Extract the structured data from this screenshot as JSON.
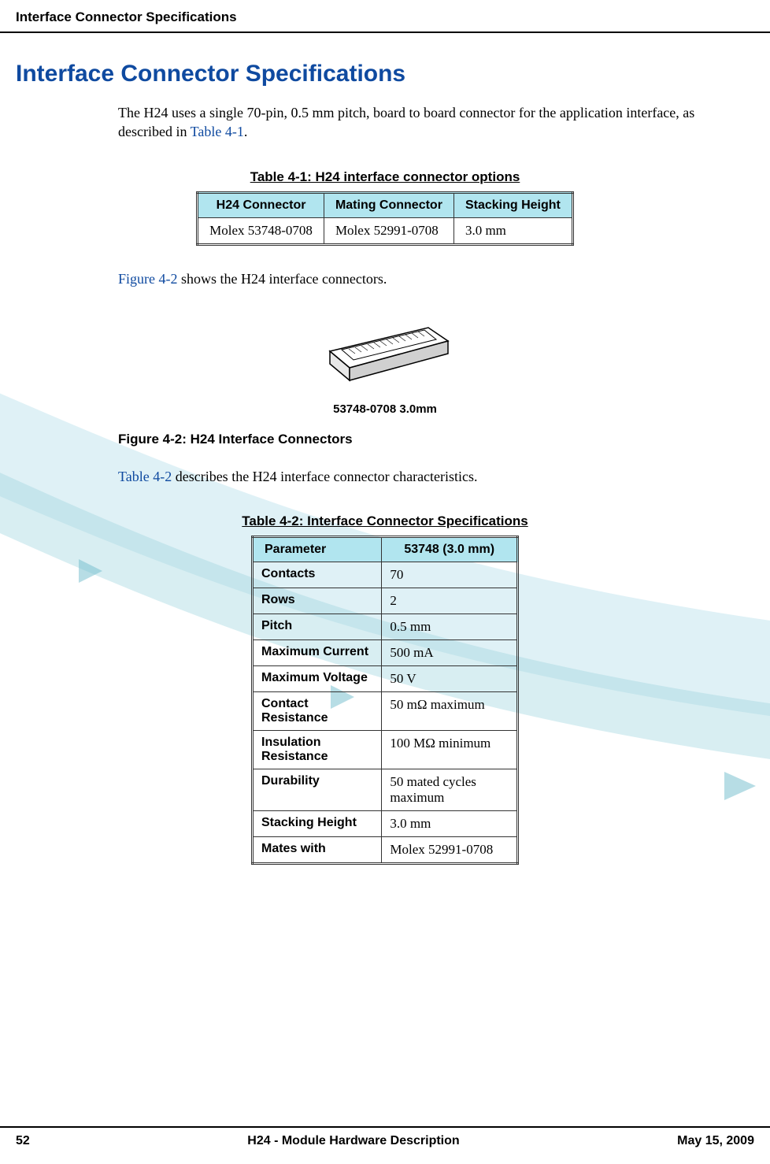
{
  "header": {
    "running_title": "Interface Connector Specifications"
  },
  "h1": "Interface Connector Specifications",
  "p1_a": "The H24 uses a single 70-pin, 0.5 mm pitch, board to board connector for the application interface, as described in ",
  "p1_link": "Table 4-1",
  "p1_b": ".",
  "table1": {
    "caption": "Table 4-1: H24 interface connector options",
    "headers": [
      "H24 Connector",
      "Mating Connector",
      "Stacking Height"
    ],
    "row": [
      "Molex 53748-0708",
      "Molex 52991-0708",
      "3.0 mm"
    ]
  },
  "p2_link": "Figure 4-2",
  "p2_b": " shows the H24 interface connectors.",
  "figure": {
    "part_label": "53748-0708 3.0mm",
    "caption": "Figure 4-2: H24 Interface Connectors"
  },
  "p3_link": "Table 4-2",
  "p3_b": " describes the H24 interface connector characteristics.",
  "table2": {
    "caption": "Table 4-2: Interface Connector Specifications",
    "headers": [
      "Parameter",
      "53748 (3.0 mm)"
    ],
    "rows": [
      [
        "Contacts",
        "70"
      ],
      [
        "Rows",
        "2"
      ],
      [
        "Pitch",
        "0.5 mm"
      ],
      [
        "Maximum Current",
        "500 mA"
      ],
      [
        "Maximum Voltage",
        "50 V"
      ],
      [
        "Contact Resistance",
        "50 mΩ maximum"
      ],
      [
        "Insulation Resistance",
        "100 MΩ minimum"
      ],
      [
        "Durability",
        "50 mated cycles maximum"
      ],
      [
        "Stacking Height",
        "3.0 mm"
      ],
      [
        "Mates with",
        "Molex 52991-0708"
      ]
    ]
  },
  "footer": {
    "page": "52",
    "center": "H24 - Module Hardware Description",
    "date": "May 15, 2009"
  }
}
